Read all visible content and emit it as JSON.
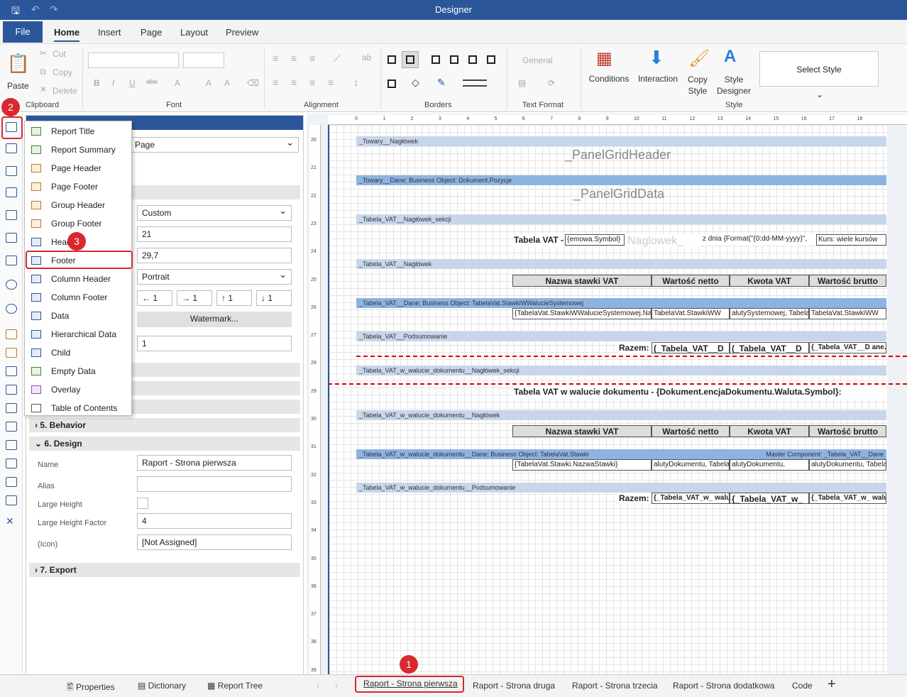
{
  "app": {
    "title": "Designer"
  },
  "menu": {
    "file": "File",
    "tabs": [
      "Home",
      "Insert",
      "Page",
      "Layout",
      "Preview"
    ]
  },
  "ribbon": {
    "clipboard": {
      "paste": "Paste",
      "cut": "Cut",
      "copy": "Copy",
      "delete": "Delete",
      "label": "Clipboard"
    },
    "font": {
      "label": "Font",
      "bold": "B",
      "italic": "I",
      "underline": "U",
      "strike": "abc"
    },
    "alignment": {
      "label": "Alignment"
    },
    "borders": {
      "label": "Borders"
    },
    "text_format": {
      "general": "General",
      "label": "Text Format"
    },
    "style": {
      "conditions": "Conditions",
      "interaction": "Interaction",
      "copy_style": "Copy Style",
      "style_designer": "Style Designer",
      "select_style": "Select Style",
      "label": "Style"
    }
  },
  "popup_menu": {
    "items": [
      "Report Title",
      "Report Summary",
      "Page Header",
      "Page Footer",
      "Group Header",
      "Group Footer",
      "Header",
      "Footer",
      "Column Header",
      "Column Footer",
      "Data",
      "Hierarchical Data",
      "Child",
      "Empty Data",
      "Overlay",
      "Table of Contents"
    ]
  },
  "properties": {
    "page_value": "Page",
    "paper_size": "Custom",
    "width": "21",
    "height": "29,7",
    "orientation": "Portrait",
    "margins": [
      "1",
      "1",
      "1",
      "1"
    ],
    "watermark": "Watermark...",
    "columns": "1",
    "section_behavior": "5. Behavior",
    "section_design": "6. Design",
    "section_export": "7. Export",
    "design": {
      "name_label": "Name",
      "name_value": "Raport - Strona pierwsza",
      "alias_label": "Alias",
      "alias_value": "",
      "large_height_label": "Large Height",
      "large_height_factor_label": "Large Height Factor",
      "large_height_factor_value": "4",
      "icon_label": "(Icon)",
      "icon_value": "[Not Assigned]",
      "ellipsis": "..."
    }
  },
  "panel_tabs": [
    "Properties",
    "Dictionary",
    "Report Tree"
  ],
  "ruler": {
    "top": [
      "0",
      "1",
      "2",
      "3",
      "4",
      "5",
      "6",
      "7",
      "8",
      "9",
      "10",
      "11",
      "12",
      "13",
      "14",
      "15",
      "16",
      "17",
      "18"
    ],
    "left": [
      "20",
      "21",
      "22",
      "23",
      "24",
      "25",
      "26",
      "27",
      "28",
      "29",
      "30",
      "31",
      "32",
      "33",
      "34",
      "35",
      "36",
      "37",
      "38",
      "39"
    ]
  },
  "report": {
    "bands": [
      "_Towary__Nagłówek",
      "_Towary__Dane; Business Object: Dokument.Pozycje",
      "_Tabela_VAT__Nagłówek_sekcji",
      "_Tabela_VAT__Nagłówek",
      "_Tabela_VAT__Dane; Business Object: TabelaVat.StawkiWWalucieSystemowej",
      "_Tabela_VAT__Podsumowanie",
      "_Tabela_VAT_w_walucie_dokumentu__Nagłówek_sekcji",
      "_Tabela_VAT_w_walucie_dokumentu__Nagłówek",
      "_Tabela_VAT_w_walucie_dokumentu__Dane; Business Object: TabelaVat.Stawki",
      "_Tabela_VAT_w_walucie_dokumentu__Podsumowanie"
    ],
    "master_component": "Master Component: _Tabela_VAT__Dane",
    "panel_grid_header": "_PanelGridHeader",
    "panel_grid_data": "_PanelGridData",
    "vat_title": "Tabela VAT - ",
    "vat_symbol": "{emowa.Symbol}",
    "vat_naglowek": "Naglowek_",
    "vat_date": "z dnia {Format(\"{0:dd-MM-yyyy}\",",
    "vat_kurs": "Kurs: wiele kursów",
    "headers": [
      "Nazwa stawki VAT",
      "Wartość netto",
      "Kwota VAT",
      "Wartość brutto"
    ],
    "data_row1": [
      "{TabelaVat.StawkiWWalucieSystemowej.NazwaStawki}",
      "TabelaVat.StawkiWW",
      "alutySystemowej, TabelaVat.StawkiWW",
      "TabelaVat.StawkiWW"
    ],
    "sum_label": "Razem:",
    "sum_row1": [
      "(_Tabela_VAT__D",
      "(_Tabela_VAT__D",
      "{_Tabela_VAT__D ane.TabelaVat.Sta"
    ],
    "doc_title": "Tabela VAT w walucie dokumentu - {Dokument.encjaDokumentu.Waluta.Symbol}:",
    "data_row2": [
      "{TabelaVat.Stawki.NazwaStawki}",
      "alutyDokumentu, TabelaVat.Stawki.War",
      "alutyDokumentu,",
      "alutyDokumentu, TabelaVat.Stawki.War"
    ],
    "sum_row2": [
      "{_Tabela_VAT_w_ walucie_dokumen",
      "{_Tabela_VAT_w_",
      "{_Tabela_VAT_w_ walucie_dokumen"
    ]
  },
  "page_tabs": [
    "Raport - Strona pierwsza",
    "Raport - Strona druga",
    "Raport - Strona trzecia",
    "Raport - Strona dodatkowa",
    "Code"
  ],
  "add_tab": "+",
  "callouts": [
    "1",
    "2",
    "3"
  ],
  "colors": {
    "accent": "#2b579a",
    "callout": "#d9282f"
  }
}
